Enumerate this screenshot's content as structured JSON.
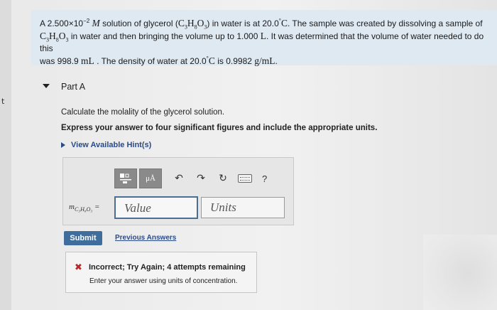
{
  "problem": {
    "t1": "A 2.500×10",
    "t1_exp": "−2",
    "t1_unit": "M",
    "t2": " solution of glycerol (",
    "formula_c": "C",
    "formula_c_sub": "3",
    "formula_h": "H",
    "formula_h_sub": "8",
    "formula_o": "O",
    "formula_o_sub": "3",
    "t3": ") in water is at 20.0",
    "deg": "°",
    "t3_unit": "C",
    "t4": ". The sample was created by dissolving a sample of",
    "t5": " in water and then bringing the volume up to 1.000 ",
    "t5_unit": "L",
    "t6": ". It was determined that the volume of water needed to do this",
    "t7": "was 998.9 ",
    "t7_unit": "mL",
    "t8": " . The density of water at 20.0",
    "t8_unit": "C",
    "t9": " is 0.9982 ",
    "t9_unit": "g/mL",
    "t10": "."
  },
  "part": {
    "title": "Part A"
  },
  "question": {
    "text": "Calculate the molality of the glycerol solution.",
    "instruction": "Express your answer to four significant figures and include the appropriate units.",
    "hints_label": "View Available Hint(s)"
  },
  "toolbar": {
    "templates_icon": "templates-icon",
    "units_label": "μÅ",
    "undo_icon": "undo-icon",
    "redo_icon": "redo-icon",
    "reset_icon": "reset-icon",
    "keyboard_icon": "keyboard-icon",
    "help_label": "?"
  },
  "answer": {
    "var_m": "m",
    "var_sub": "C₃H₈O₃",
    "var_eq": " =",
    "value_placeholder": "Value",
    "units_placeholder": "Units"
  },
  "actions": {
    "submit_label": "Submit",
    "previous_label": "Previous Answers"
  },
  "feedback": {
    "title": "Incorrect; Try Again; 4 attempts remaining",
    "message": "Enter your answer using units of concentration.",
    "color": "#b5282e"
  },
  "edge": {
    "mark": "t"
  }
}
